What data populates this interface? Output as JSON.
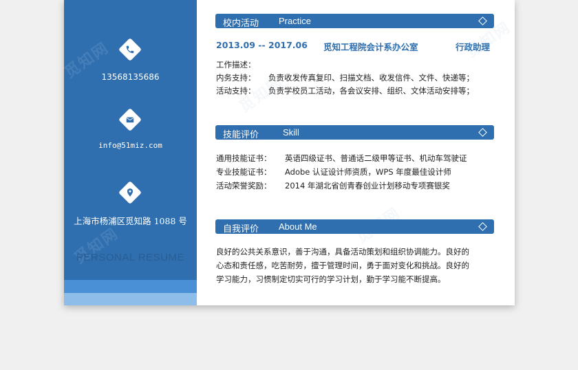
{
  "sidebar": {
    "phone": "13568135686",
    "email": "info@51miz.com",
    "address": "上海市杨浦区觅知路 1088 号",
    "personal_resume": "PERSONAL RESUME"
  },
  "sections": {
    "practice": {
      "cn": "校内活动",
      "en": "Practice",
      "period": "2013.09 -- 2017.06",
      "org": "觅知工程院会计系办公室",
      "role": "行政助理",
      "desc_title": "工作描述：",
      "items": [
        {
          "label": "内务支持：",
          "text": "负责收发传真复印、扫描文档、收发信件、文件、快递等；"
        },
        {
          "label": "活动支持：",
          "text": "负责学校员工活动，各会议安排、组织、文体活动安排等；"
        }
      ]
    },
    "skill": {
      "cn": "技能评价",
      "en": "Skill",
      "items": [
        {
          "label": "通用技能证书：",
          "text": "英语四级证书、普通话二级甲等证书、机动车驾驶证"
        },
        {
          "label": "专业技能证书：",
          "text": "Adobe 认证设计师资质，WPS 年度最佳设计师"
        },
        {
          "label": "活动荣誉奖励：",
          "text": "2014 年湖北省创青春创业计划移动专项赛银奖"
        }
      ]
    },
    "about": {
      "cn": "自我评价",
      "en": "About Me",
      "lines": [
        "良好的公共关系意识，善于沟通，具备活动策划和组织协调能力。良好的",
        "心态和责任感，吃苦耐劳，擅于管理时间，勇于面对变化和挑战。良好的",
        "学习能力，习惯制定切实可行的学习计划，勤于学习能不断提高。"
      ]
    }
  },
  "watermark_text": "觅知网",
  "colors": {
    "primary": "#2f6faf",
    "band_mid": "#4a90d6",
    "band_light": "#8dbde8"
  },
  "icons": [
    "phone-icon",
    "mail-icon",
    "location-icon",
    "diamond-icon"
  ]
}
